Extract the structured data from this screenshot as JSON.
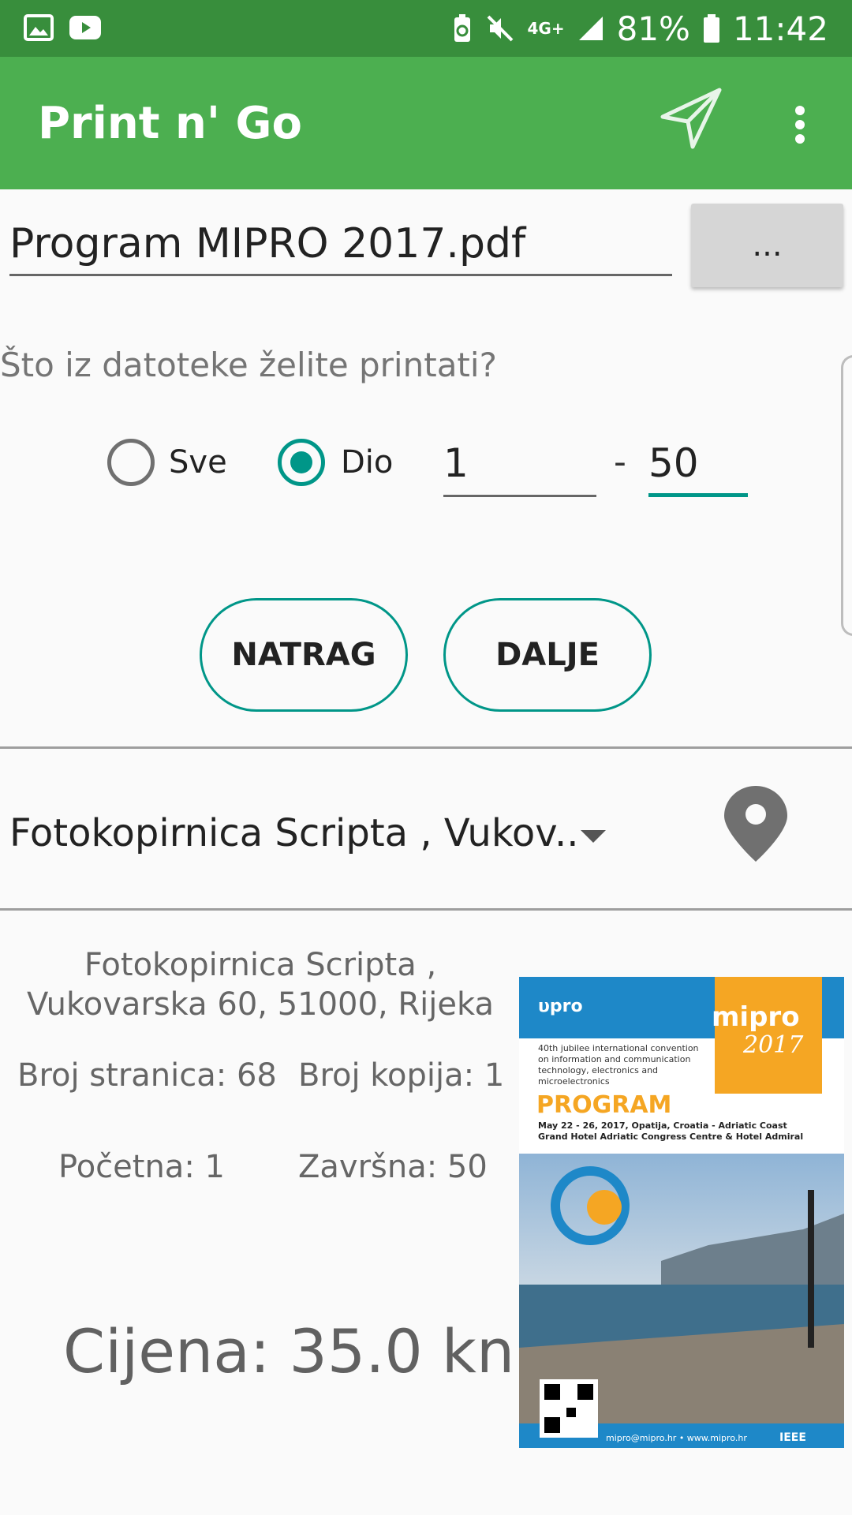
{
  "status_bar": {
    "battery": "81%",
    "time": "11:42",
    "network": "4G+"
  },
  "app_bar": {
    "title": "Print n' Go",
    "send_icon": "send-icon",
    "more_icon": "more-vert-icon"
  },
  "file": {
    "name": "Program MIPRO 2017.pdf",
    "browse_label": "..."
  },
  "print_options": {
    "question": "Što iz datoteke želite printati?",
    "option_all": "Sve",
    "option_part": "Dio",
    "selected": "Dio",
    "page_from": "1",
    "page_to": "50",
    "dash": "-"
  },
  "buttons": {
    "back": "NATRAG",
    "next": "DALJE"
  },
  "location": {
    "selected": "Fotokopirnica Scripta , Vukov..",
    "pin_icon": "location-pin-icon"
  },
  "summary": {
    "shop_line1": "Fotokopirnica Scripta ,",
    "shop_line2": "Vukovarska 60, 51000, Rijeka",
    "page_count": "Broj stranica: 68",
    "copies": "Broj kopija: 1",
    "start": "Početna: 1",
    "end": "Završna: 50",
    "price": "Cijena: 35.0 kn"
  },
  "colors": {
    "status_bar": "#388e3c",
    "app_bar": "#4caf50",
    "accent": "#009688"
  }
}
